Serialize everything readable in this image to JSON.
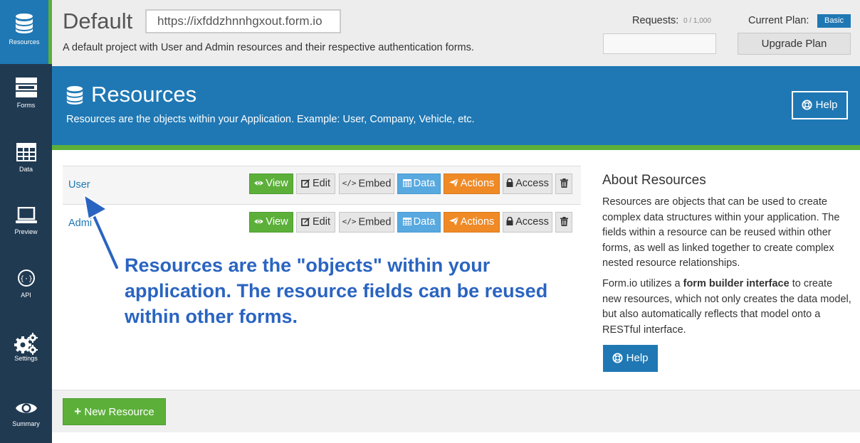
{
  "sidebar": {
    "items": [
      {
        "label": "Resources",
        "icon": "database-icon",
        "active": true
      },
      {
        "label": "Forms",
        "icon": "forms-icon"
      },
      {
        "label": "Data",
        "icon": "table-icon"
      },
      {
        "label": "Preview",
        "icon": "laptop-icon"
      },
      {
        "label": "API",
        "icon": "api-icon"
      },
      {
        "label": "Settings",
        "icon": "gears-icon"
      },
      {
        "label": "Summary",
        "icon": "eye-icon"
      }
    ]
  },
  "project": {
    "title": "Default",
    "url": "https://ixfddzhnnhgxout.form.io",
    "description": "A default project with User and Admin resources and their respective authentication forms.",
    "requests_label": "Requests:",
    "requests_count": "0 / 1,000",
    "plan_label": "Current Plan:",
    "plan_badge": "Basic",
    "upgrade_label": "Upgrade Plan"
  },
  "header": {
    "title": "Resources",
    "subtitle": "Resources are the objects within your Application. Example: User, Company, Vehicle, etc.",
    "help_label": "Help"
  },
  "resources": [
    {
      "name": "User"
    },
    {
      "name": "Admi"
    }
  ],
  "row_buttons": {
    "view": "View",
    "edit": "Edit",
    "embed": "Embed",
    "data": "Data",
    "actions": "Actions",
    "access": "Access"
  },
  "annotation": {
    "text": "Resources are the \"objects\" within your application. The resource fields can be reused within other forms."
  },
  "about": {
    "title": "About Resources",
    "p1": "Resources are objects that can be used to create complex data structures within your application. The fields within a resource can be reused within other forms, as well as linked together to create complex nested resource relationships.",
    "p2_pre": "Form.io utilizes a ",
    "p2_bold": "form builder interface",
    "p2_post": " to create new resources, which not only creates the data model, but also automatically reflects that model onto a RESTful interface.",
    "help_label": "Help"
  },
  "footer": {
    "new_resource_label": "New Resource"
  },
  "colors": {
    "sidebar_bg": "#203a52",
    "primary_blue": "#1f78b4",
    "green": "#5cb03a",
    "orange": "#ef8a27",
    "light_blue": "#58a9e0"
  }
}
